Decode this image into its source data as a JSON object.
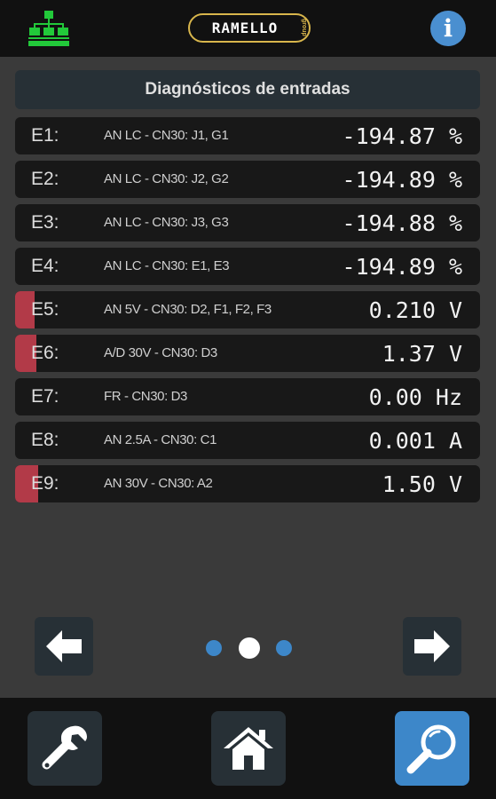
{
  "header": {
    "logo_text": "RAMELLO",
    "logo_sub": "group",
    "info_label": "i"
  },
  "section": {
    "title": "Diagnósticos de entradas"
  },
  "inputs": [
    {
      "label": "E1:",
      "desc": "AN LC - CN30: J1, G1",
      "value": "-194.87 %",
      "level": 0
    },
    {
      "label": "E2:",
      "desc": "AN LC - CN30: J2, G2",
      "value": "-194.89 %",
      "level": 0
    },
    {
      "label": "E3:",
      "desc": "AN LC - CN30: J3, G3",
      "value": "-194.88 %",
      "level": 0
    },
    {
      "label": "E4:",
      "desc": "AN LC - CN30: E1, E3",
      "value": "-194.89 %",
      "level": 0
    },
    {
      "label": "E5:",
      "desc": "AN 5V - CN30: D2, F1, F2, F3",
      "value": "0.210 V",
      "level": 0.042
    },
    {
      "label": "E6:",
      "desc": "A/D 30V - CN30: D3",
      "value": "1.37 V",
      "level": 0.046
    },
    {
      "label": "E7:",
      "desc": "FR - CN30: D3",
      "value": "0.00 Hz",
      "level": 0
    },
    {
      "label": "E8:",
      "desc": "AN 2.5A - CN30: C1",
      "value": "0.001 A",
      "level": 0
    },
    {
      "label": "E9:",
      "desc": "AN 30V - CN30: A2",
      "value": "1.50 V",
      "level": 0.05
    }
  ],
  "pager": {
    "current_page": 2,
    "page_count": 3
  },
  "colors": {
    "level_bar": "#b23a48",
    "network_icon": "#22c93a",
    "logo_border": "#d8b64c",
    "info_button": "#4a8fd0",
    "search_button": "#3d87c9",
    "dot_active": "#ffffff",
    "dot_inactive": "#3d87c9"
  },
  "icons": {
    "network": "network-icon",
    "info": "info-icon",
    "prev": "arrow-left-icon",
    "next": "arrow-right-icon",
    "settings": "wrench-icon",
    "home": "home-icon",
    "search": "magnifier-icon"
  }
}
